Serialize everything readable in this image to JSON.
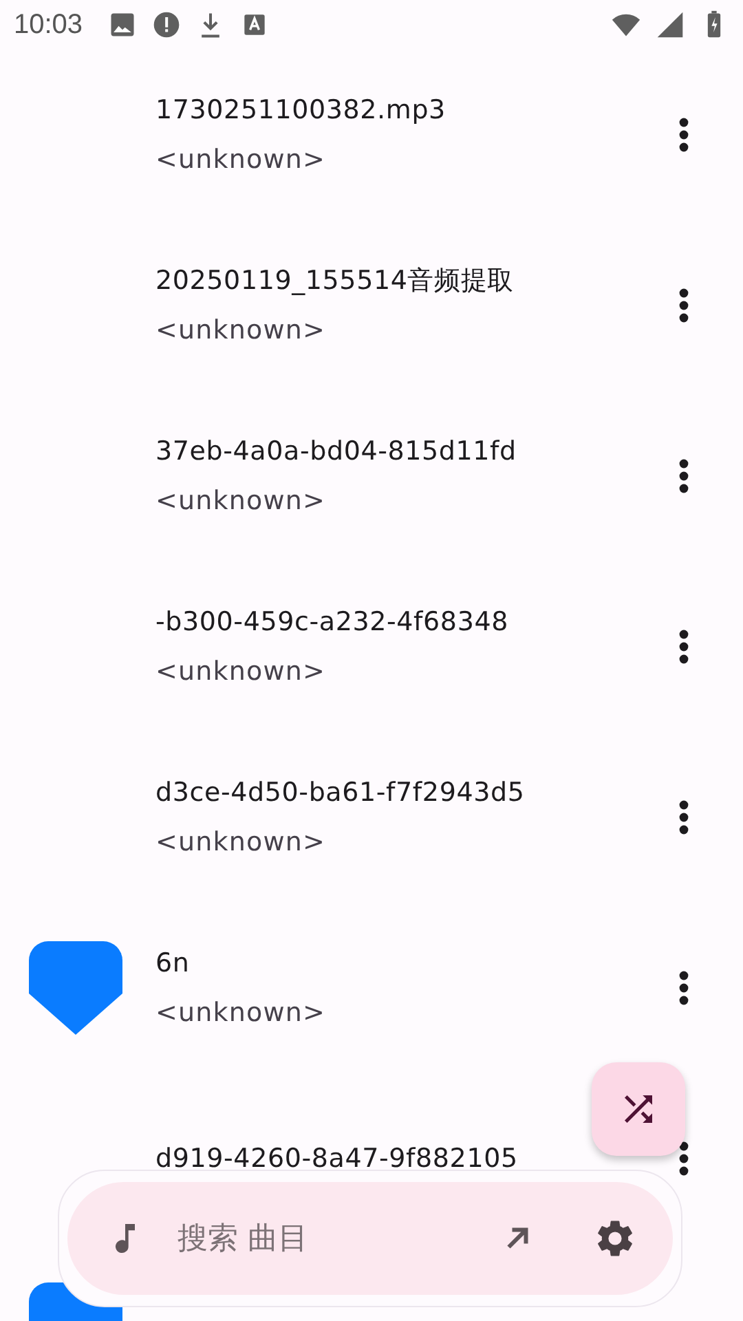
{
  "status_bar": {
    "time": "10:03"
  },
  "songs": [
    {
      "title": "1730251100382.mp3",
      "artist": "<unknown>",
      "thumbnail": false
    },
    {
      "title": "20250119_155514音频提取",
      "artist": "<unknown>",
      "thumbnail": false
    },
    {
      "title": "37eb-4a0a-bd04-815d11fd",
      "artist": "<unknown>",
      "thumbnail": false
    },
    {
      "title": "-b300-459c-a232-4f68348",
      "artist": "<unknown>",
      "thumbnail": false
    },
    {
      "title": "d3ce-4d50-ba61-f7f2943d5",
      "artist": "<unknown>",
      "thumbnail": false
    },
    {
      "title": "6n",
      "artist": "<unknown>",
      "thumbnail": true
    },
    {
      "title": "d919-4260-8a47-9f882105",
      "thumbnail": false
    },
    {
      "thumbnail": true
    }
  ],
  "search": {
    "placeholder": "搜索 曲目"
  }
}
